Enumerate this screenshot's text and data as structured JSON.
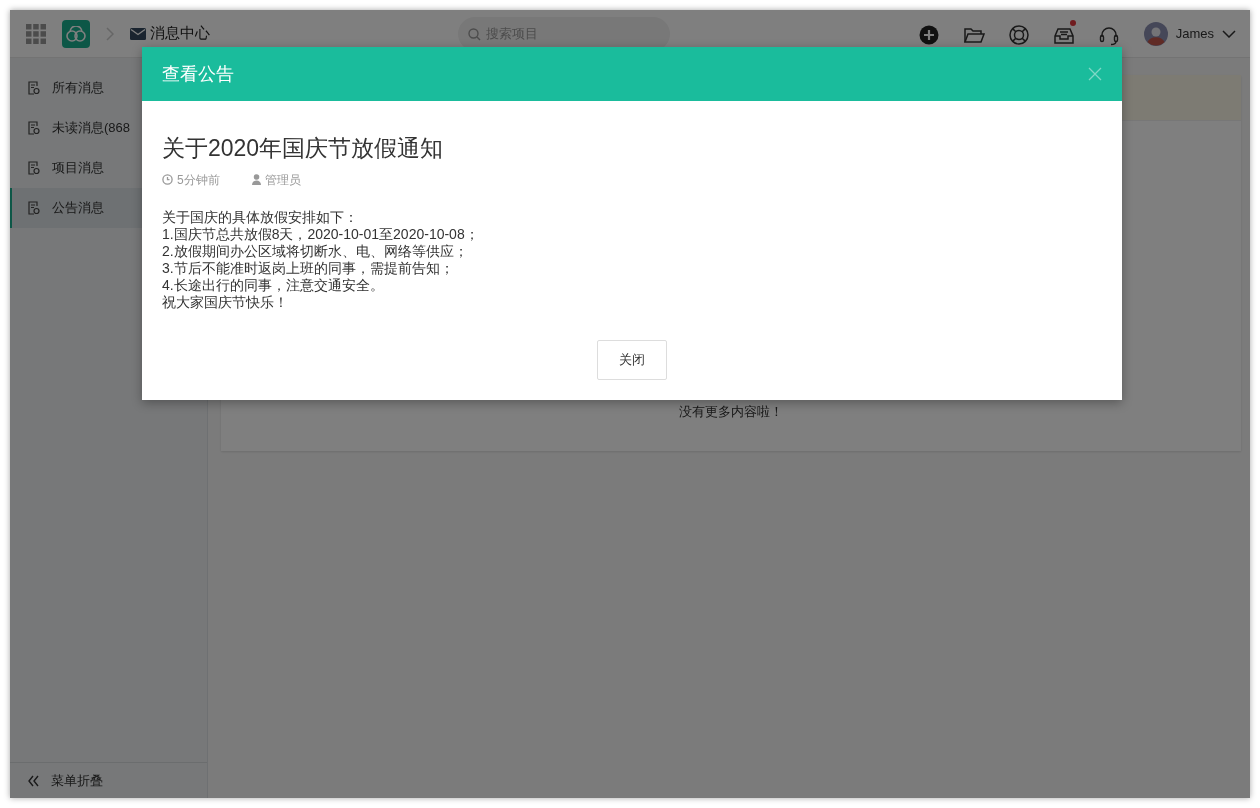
{
  "topbar": {
    "breadcrumb": "消息中心",
    "search": {
      "placeholder": "搜索项目"
    },
    "icons": [
      {
        "kind": "add",
        "dot": false
      },
      {
        "kind": "folder",
        "dot": false
      },
      {
        "kind": "help",
        "dot": false
      },
      {
        "kind": "inbox",
        "dot": true
      },
      {
        "kind": "headset",
        "dot": false
      }
    ],
    "user": "James"
  },
  "sidebar": {
    "items": [
      {
        "label": "所有消息",
        "selected": false
      },
      {
        "label": "未读消息(868",
        "selected": false
      },
      {
        "label": "项目消息",
        "selected": false
      },
      {
        "label": "公告消息",
        "selected": true
      }
    ],
    "footer": "菜单折叠"
  },
  "content": {
    "empty_text": "没有更多内容啦！"
  },
  "modal": {
    "title": "查看公告",
    "heading": "关于2020年国庆节放假通知",
    "time": "5分钟前",
    "author": "管理员",
    "body": [
      "关于国庆的具体放假安排如下：",
      "1.国庆节总共放假8天，2020-10-01至2020-10-08；",
      "2.放假期间办公区域将切断水、电、网络等供应；",
      "3.节后不能准时返岗上班的同事，需提前告知；",
      "4.长途出行的同事，注意交通安全。",
      "祝大家国庆节快乐！"
    ],
    "close_button": "关闭"
  }
}
